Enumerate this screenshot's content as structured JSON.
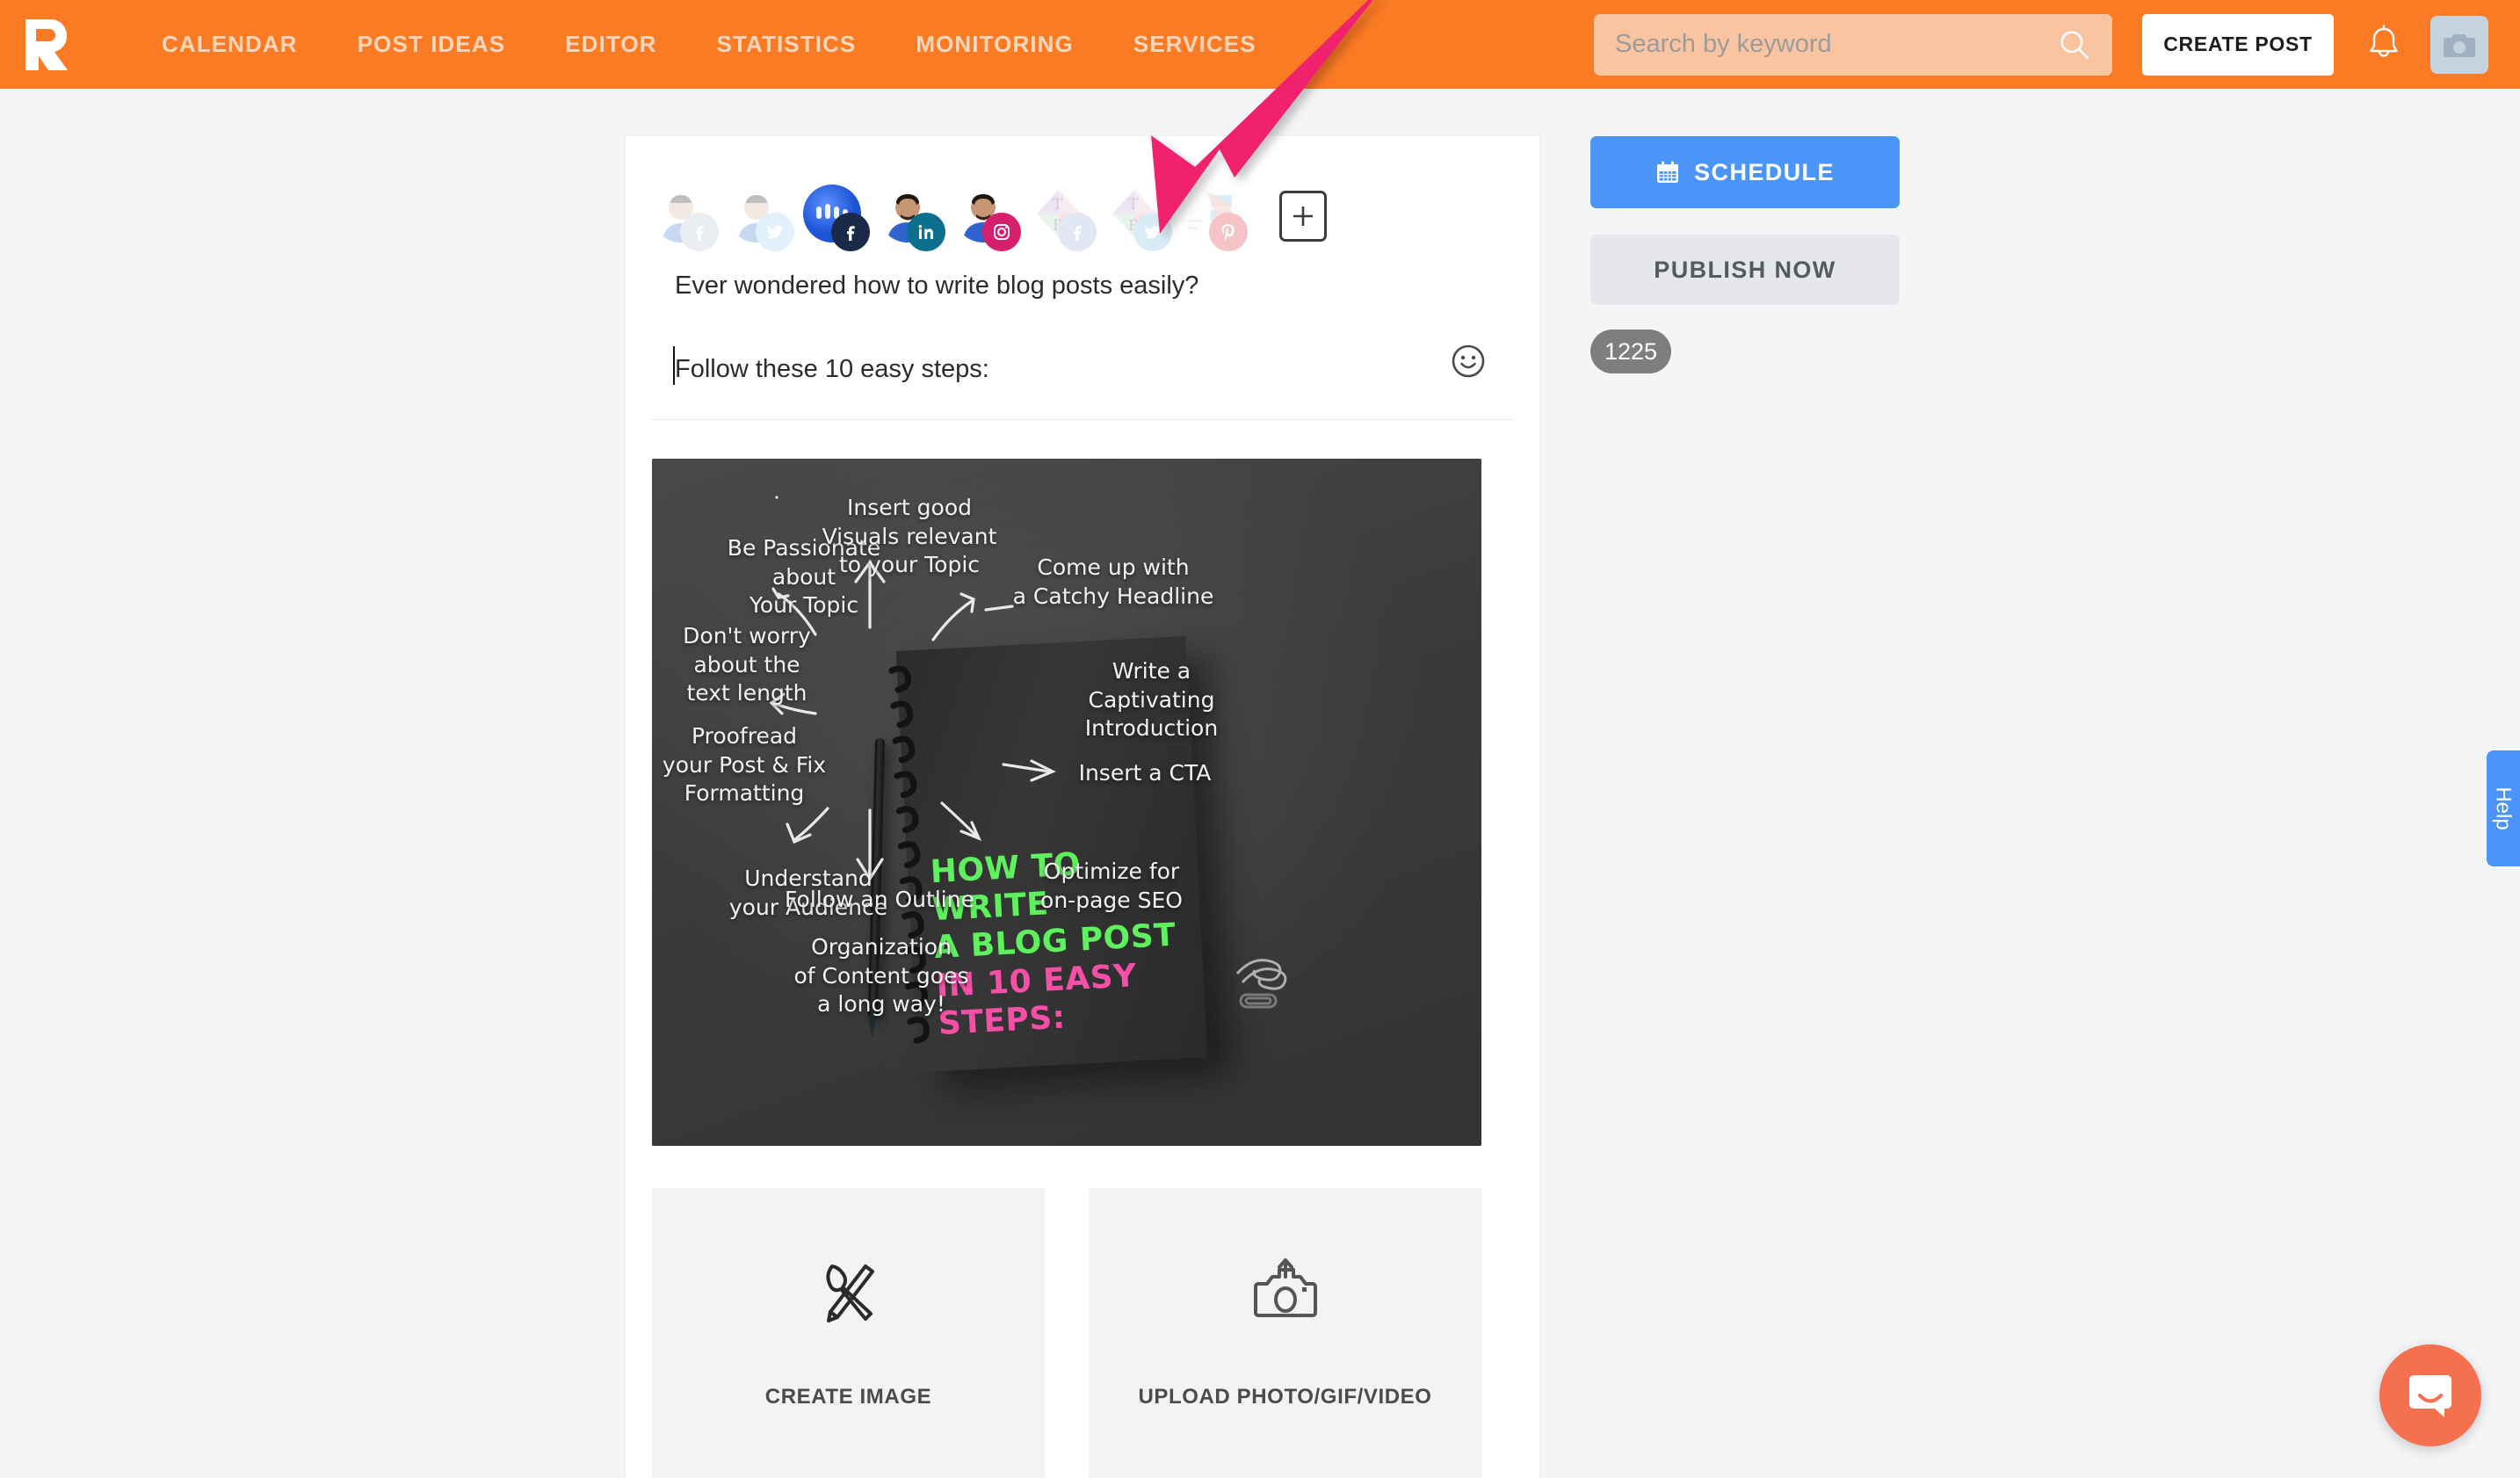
{
  "header": {
    "logo": "promorepublic-logo",
    "nav": [
      {
        "label": "CALENDAR",
        "name": "nav-calendar"
      },
      {
        "label": "POST IDEAS",
        "name": "nav-post-ideas"
      },
      {
        "label": "EDITOR",
        "name": "nav-editor"
      },
      {
        "label": "STATISTICS",
        "name": "nav-statistics"
      },
      {
        "label": "MONITORING",
        "name": "nav-monitoring"
      },
      {
        "label": "SERVICES",
        "name": "nav-services"
      }
    ],
    "search": {
      "placeholder": "Search by keyword",
      "value": ""
    },
    "create_post_label": "CREATE POST",
    "icons": {
      "bell": "bell-icon",
      "avatar": "camera-icon"
    },
    "colors": {
      "bar": "#fb7a24",
      "search_field": "#fbc4a0",
      "nav_text": "#fdd7bb"
    }
  },
  "composer": {
    "profiles": [
      {
        "network": "facebook",
        "active": false,
        "name": "profile-facebook-1"
      },
      {
        "network": "twitter",
        "active": false,
        "name": "profile-twitter-1"
      },
      {
        "network": "facebook",
        "active": true,
        "name": "profile-facebook-page"
      },
      {
        "network": "linkedin",
        "active": true,
        "name": "profile-linkedin"
      },
      {
        "network": "instagram",
        "active": true,
        "name": "profile-instagram"
      },
      {
        "network": "facebook",
        "active": false,
        "name": "profile-facebook-2"
      },
      {
        "network": "twitter",
        "active": false,
        "name": "profile-twitter-2"
      },
      {
        "network": "pinterest",
        "active": false,
        "name": "profile-pinterest"
      }
    ],
    "add_profile_label": "+",
    "post_text_line1": "Ever wondered how to write blog posts easily?",
    "post_text_line2": "Follow these 10 easy steps:",
    "emoji_button": "emoji-icon",
    "tiles": [
      {
        "label": "CREATE IMAGE",
        "icon": "brush-pencil-icon",
        "name": "create-image-tile"
      },
      {
        "label": "UPLOAD PHOTO/GIF/VIDEO",
        "icon": "camera-upload-icon",
        "name": "upload-media-tile"
      }
    ]
  },
  "media": {
    "title_lines": [
      "HOW TO WRITE",
      "A BLOG POST",
      "IN 10 EASY STEPS:"
    ],
    "annotations": [
      "Be Passionate\nabout\nYour Topic",
      "Insert good\nVisuals relevant\nto your Topic",
      "Come up with\na Catchy Headline",
      "Don't worry\nabout the\ntext length",
      "Write a\nCaptivating\nIntroduction",
      "Proofread\nyour Post & Fix\nFormatting",
      "Insert a CTA",
      "Understand\nyour Audience",
      "Follow an Outline",
      "Optimize for\non-page SEO",
      "Organization\nof Content goes\na long way!"
    ],
    "colors": {
      "background": "#3c3c3c",
      "green": "#5ef05e",
      "pink": "#f54fa8"
    }
  },
  "sidebar": {
    "schedule_label": "SCHEDULE",
    "schedule_icon": "calendar-icon",
    "publish_label": "PUBLISH NOW",
    "character_count": "1225",
    "colors": {
      "schedule": "#4a95f7",
      "publish": "#e6e7eb",
      "counter": "#7e7e7e"
    }
  },
  "help": {
    "label": "Help"
  },
  "chat": {
    "icon": "intercom-chat-icon",
    "color": "#f4704f"
  },
  "annotation": {
    "arrow": "pink-pointer-arrow",
    "color": "#f0246e"
  }
}
